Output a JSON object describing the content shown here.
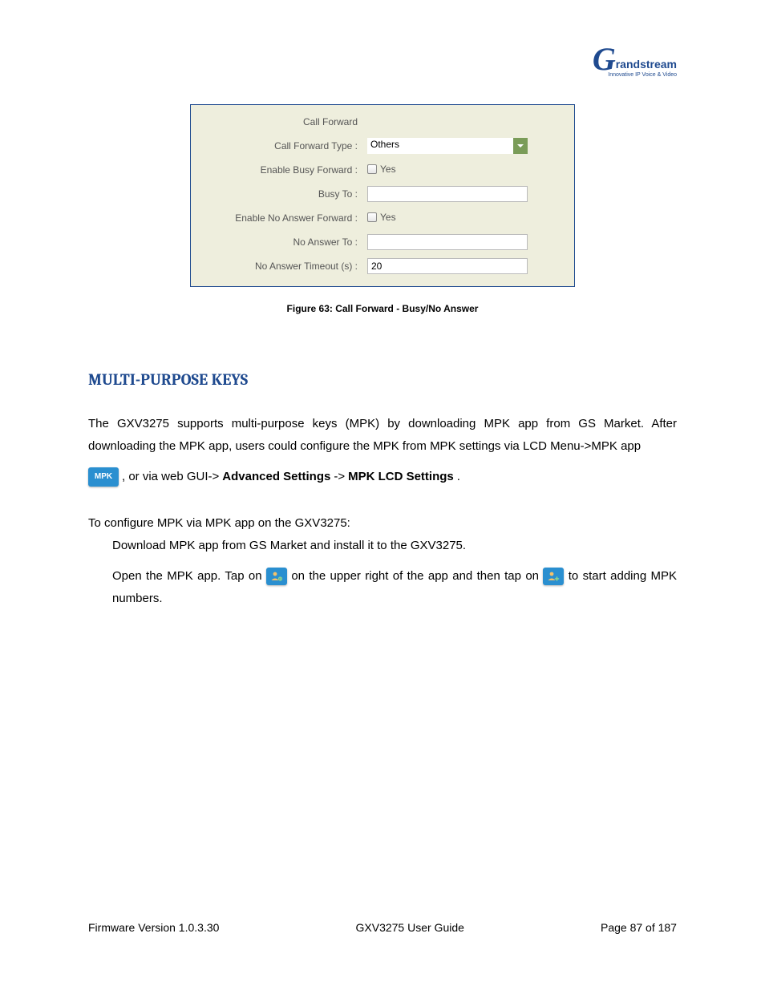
{
  "logo": {
    "brand": "Grandstream",
    "tagline": "Innovative IP Voice & Video"
  },
  "panel": {
    "title": "Call Forward",
    "rows": {
      "type_label": "Call Forward Type :",
      "type_value": "Others",
      "busy_enable_label": "Enable Busy Forward :",
      "busy_enable_yes": "Yes",
      "busy_to_label": "Busy To :",
      "busy_to_value": "",
      "noans_enable_label": "Enable No Answer Forward :",
      "noans_enable_yes": "Yes",
      "noans_to_label": "No Answer To :",
      "noans_to_value": "",
      "noans_timeout_label": "No Answer Timeout (s) :",
      "noans_timeout_value": "20"
    }
  },
  "figure_caption": "Figure 63: Call Forward - Busy/No Answer",
  "heading": "MULTI-PURPOSE KEYS",
  "paragraph1": "The GXV3275 supports multi-purpose keys (MPK) by downloading MPK app from GS Market. After downloading the MPK app, users could configure the MPK from MPK settings via LCD Menu->MPK app",
  "paragraph2_parts": {
    "mpk_icon_text": "MPK",
    "mid": ", or via web GUI->",
    "bold1": "Advanced Settings",
    "arrow": "->",
    "bold2": "MPK LCD Settings",
    "dot": "."
  },
  "intro_line": "To configure MPK via MPK app on the GXV3275:",
  "list": {
    "item1": "Download MPK app from GS Market and install it to the GXV3275.",
    "item2a": "Open the MPK app. Tap on",
    "item2b": "on the upper right of the app and then tap on",
    "item2c": "to start adding MPK numbers."
  },
  "footer": {
    "left": "Firmware Version 1.0.3.30",
    "center": "GXV3275 User Guide",
    "right": "Page 87 of 187"
  }
}
